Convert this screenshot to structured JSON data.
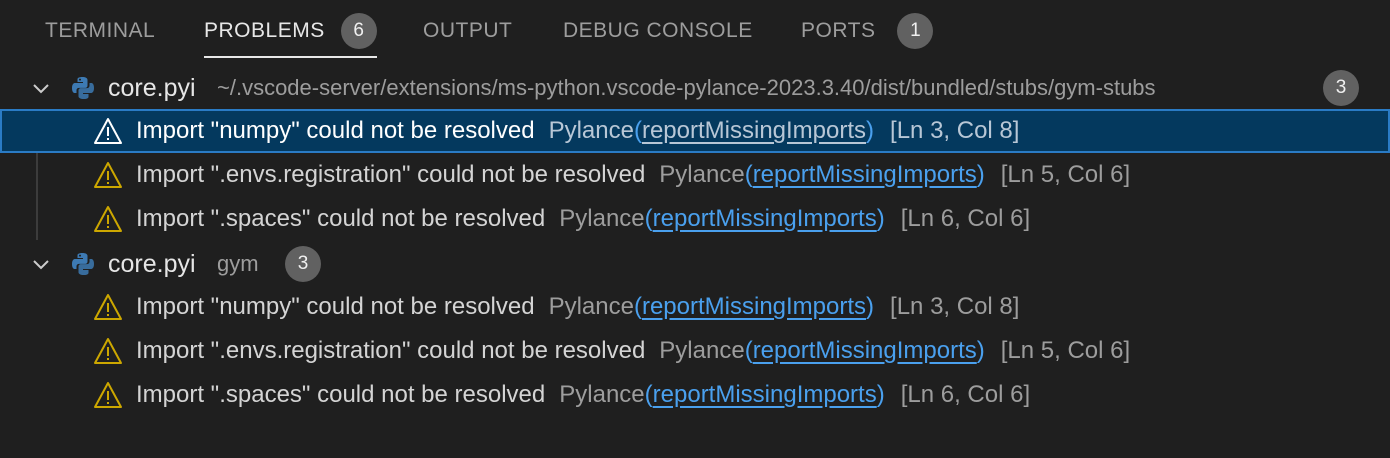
{
  "tabs": [
    {
      "label": "TERMINAL",
      "active": false
    },
    {
      "label": "PROBLEMS",
      "active": true,
      "badge": "6"
    },
    {
      "label": "OUTPUT",
      "active": false
    },
    {
      "label": "DEBUG CONSOLE",
      "active": false
    },
    {
      "label": "PORTS",
      "active": false,
      "badge": "1"
    }
  ],
  "groups": [
    {
      "file": "core.pyi",
      "path": "~/.vscode-server/extensions/ms-python.vscode-pylance-2023.3.40/dist/bundled/stubs/gym-stubs",
      "count": "3",
      "problems": [
        {
          "message": "Import \"numpy\" could not be resolved",
          "source": "Pylance",
          "code": "reportMissingImports",
          "position": "[Ln 3, Col 8]",
          "selected": true
        },
        {
          "message": "Import \".envs.registration\" could not be resolved",
          "source": "Pylance",
          "code": "reportMissingImports",
          "position": "[Ln 5, Col 6]"
        },
        {
          "message": "Import \".spaces\" could not be resolved",
          "source": "Pylance",
          "code": "reportMissingImports",
          "position": "[Ln 6, Col 6]"
        }
      ]
    },
    {
      "file": "core.pyi",
      "path": "gym",
      "count": "3",
      "problems": [
        {
          "message": "Import \"numpy\" could not be resolved",
          "source": "Pylance",
          "code": "reportMissingImports",
          "position": "[Ln 3, Col 8]"
        },
        {
          "message": "Import \".envs.registration\" could not be resolved",
          "source": "Pylance",
          "code": "reportMissingImports",
          "position": "[Ln 5, Col 6]"
        },
        {
          "message": "Import \".spaces\" could not be resolved",
          "source": "Pylance",
          "code": "reportMissingImports",
          "position": "[Ln 6, Col 6]"
        }
      ]
    }
  ],
  "colors": {
    "warning": "#cca700",
    "link": "#4aa0ee",
    "selection": "#04395e"
  },
  "icons": {
    "chevron": "chevron-down-icon",
    "file": "python-icon",
    "problem": "warning-icon"
  }
}
